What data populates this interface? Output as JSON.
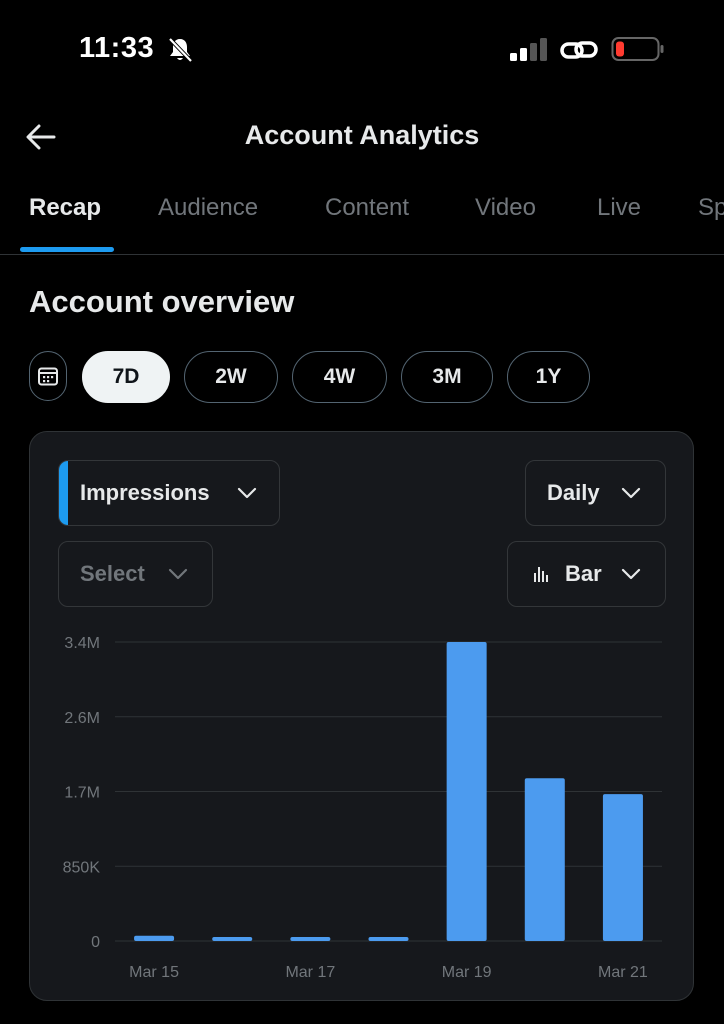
{
  "status_bar": {
    "time": "11:33",
    "icons": [
      "bell-slash-icon",
      "cellular-signal-icon",
      "link-icon",
      "battery-low-icon"
    ]
  },
  "header": {
    "title": "Account Analytics",
    "back_icon": "arrow-left-icon"
  },
  "tabs": [
    {
      "label": "Recap",
      "active": true
    },
    {
      "label": "Audience",
      "active": false
    },
    {
      "label": "Content",
      "active": false
    },
    {
      "label": "Video",
      "active": false
    },
    {
      "label": "Live",
      "active": false
    },
    {
      "label": "Sp",
      "active": false
    }
  ],
  "overview": {
    "title": "Account overview",
    "calendar_icon": "calendar-icon",
    "ranges": [
      {
        "label": "7D",
        "active": true
      },
      {
        "label": "2W",
        "active": false
      },
      {
        "label": "4W",
        "active": false
      },
      {
        "label": "3M",
        "active": false
      },
      {
        "label": "1Y",
        "active": false
      }
    ]
  },
  "controls": {
    "metric": "Impressions",
    "interval": "Daily",
    "compare_placeholder": "Select",
    "chart_type": "Bar"
  },
  "colors": {
    "accent": "#1d9bf0",
    "bar": "#4c9bef",
    "background": "#000000",
    "card": "#16181c",
    "muted_text": "#71767b"
  },
  "chart_data": {
    "type": "bar",
    "categories": [
      "Mar 15",
      "Mar 16",
      "Mar 17",
      "Mar 18",
      "Mar 19",
      "Mar 20",
      "Mar 21"
    ],
    "values": [
      60000,
      25000,
      20000,
      40000,
      3400000,
      1850000,
      1670000
    ],
    "x_tick_labels": [
      "Mar 15",
      "Mar 17",
      "Mar 19",
      "Mar 21"
    ],
    "y_tick_labels": [
      "0",
      "850K",
      "1.7M",
      "2.6M",
      "3.4M"
    ],
    "y_tick_values": [
      0,
      850000,
      1700000,
      2550000,
      3400000
    ],
    "ylim": [
      0,
      3400000
    ],
    "grid": true
  }
}
